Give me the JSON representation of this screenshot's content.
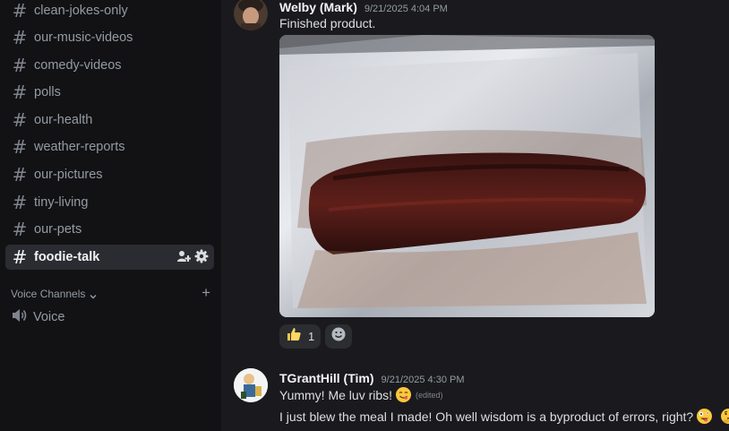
{
  "sidebar": {
    "channels": [
      {
        "label": "clean-jokes-only"
      },
      {
        "label": "our-music-videos"
      },
      {
        "label": "comedy-videos"
      },
      {
        "label": "polls"
      },
      {
        "label": "our-health"
      },
      {
        "label": "weather-reports"
      },
      {
        "label": "our-pictures"
      },
      {
        "label": "tiny-living"
      },
      {
        "label": "our-pets"
      },
      {
        "label": "foodie-talk",
        "active": true
      }
    ],
    "hash_glyph": "#",
    "voice_section_label": "Voice Channels",
    "voice_channel": "Voice"
  },
  "messages": [
    {
      "author": "Welby (Mark)",
      "timestamp": "9/21/2025 4:04 PM",
      "text": "Finished product.",
      "reaction": {
        "emoji": "thumbs-up",
        "count": "1"
      }
    },
    {
      "author": "TGrantHill (Tim)",
      "timestamp": "9/21/2025 4:30 PM",
      "line1": "Yummy! Me luv ribs!",
      "edited": "(edited)",
      "line2": "I just blew the meal I made! Oh well wisdom is a byproduct of errors, right?"
    }
  ],
  "colors": {
    "sidebar_bg": "#121214",
    "chat_bg": "#1a1a1e",
    "active_channel_bg": "#2b2c31",
    "muted_text": "#949ba4"
  }
}
